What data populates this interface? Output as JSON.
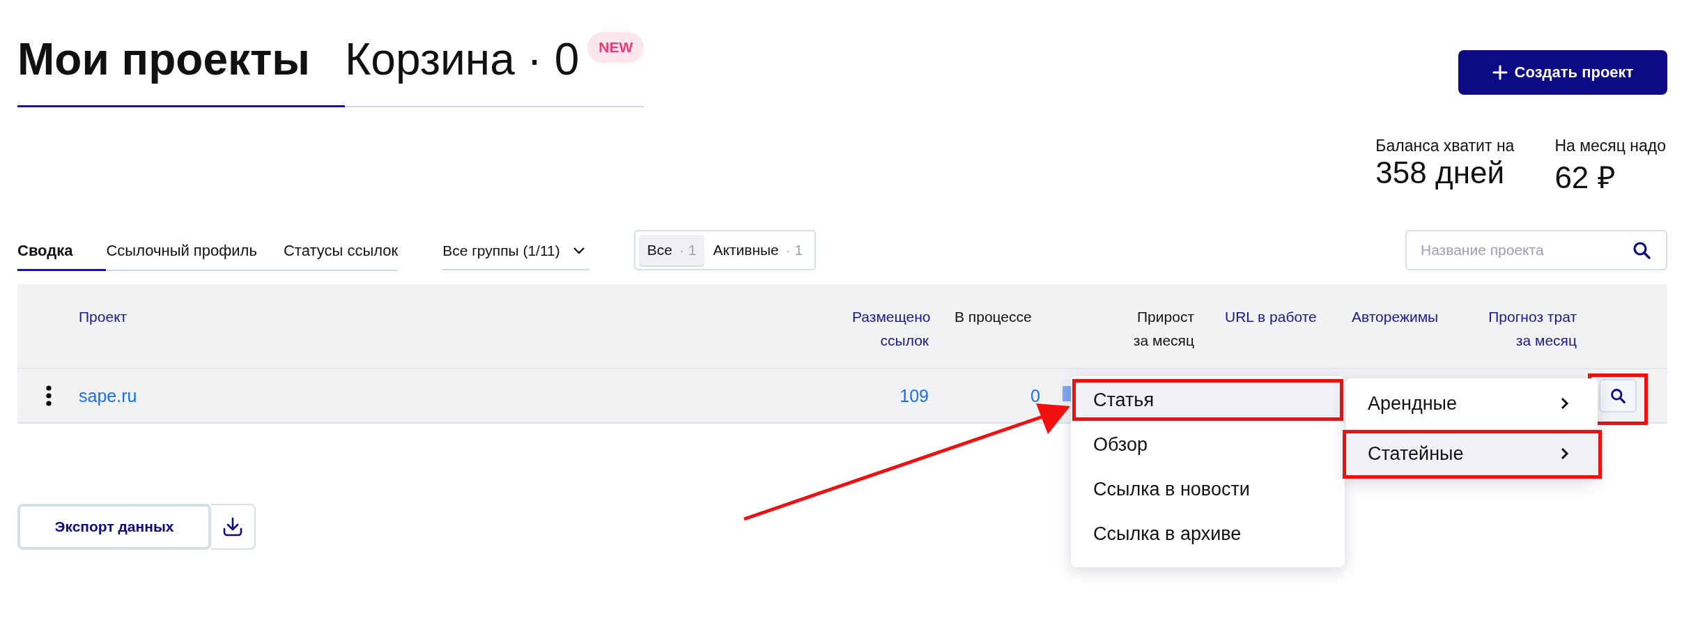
{
  "header_tabs": [
    {
      "label": "Мои проекты",
      "selected": true
    },
    {
      "label": "Корзина · 0",
      "selected": false,
      "badge": "NEW"
    }
  ],
  "create_button": {
    "label": "Создать проект"
  },
  "balance": [
    {
      "label": "Баланса хватит на",
      "value": "358 дней"
    },
    {
      "label": "На месяц надо",
      "value": "62 ₽"
    }
  ],
  "view_tabs": [
    {
      "label": "Сводка",
      "selected": true
    },
    {
      "label": "Ссылочный профиль",
      "selected": false
    },
    {
      "label": "Статусы ссылок",
      "selected": false
    }
  ],
  "group_select": {
    "value": "Все группы (1/11)"
  },
  "status_filter": [
    {
      "label": "Все",
      "count": "· 1",
      "selected": true
    },
    {
      "label": "Активные",
      "count": "· 1",
      "selected": false
    }
  ],
  "search": {
    "placeholder": "Название проекта"
  },
  "table": {
    "columns": [
      {
        "label": "Проект",
        "sortable": true
      },
      {
        "label": "Размещено ссылок",
        "sortable": true
      },
      {
        "label": "В процессе",
        "sortable": false
      },
      {
        "label": "Прирост за месяц",
        "sortable": false
      },
      {
        "label": "URL в работе",
        "sortable": true
      },
      {
        "label": "Авторежимы",
        "sortable": true
      },
      {
        "label": "Прогноз трат за месяц",
        "sortable": true
      }
    ],
    "rows": [
      {
        "project": "sape.ru",
        "placed": "109",
        "in_progress": "0",
        "action_annotated": true
      }
    ]
  },
  "menu": {
    "items": [
      {
        "label": "Статья",
        "selected": true,
        "annotated": true
      },
      {
        "label": "Обзор",
        "selected": false,
        "annotated": false
      },
      {
        "label": "Ссылка в новости",
        "selected": false,
        "annotated": false
      },
      {
        "label": "Ссылка в архиве",
        "selected": false,
        "annotated": false
      }
    ]
  },
  "submenu": {
    "items": [
      {
        "label": "Арендные",
        "selected": false,
        "annotated": false
      },
      {
        "label": "Статейные",
        "selected": true,
        "annotated": true
      }
    ]
  },
  "export_button": {
    "label": "Экспорт данных"
  }
}
